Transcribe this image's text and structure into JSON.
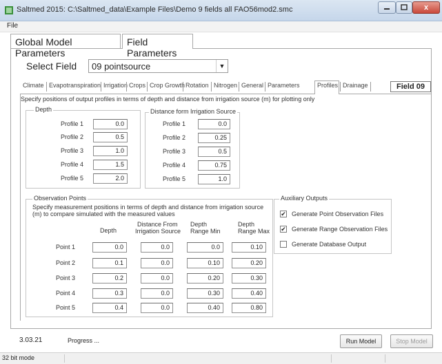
{
  "window": {
    "title": "Saltmed 2015: C:\\Saltmed_data\\Example Files\\Demo 9 fields all FAO56mod2.smc",
    "close_label": "x"
  },
  "menu": {
    "file": "File"
  },
  "main_tabs": [
    {
      "label": "Global Model Parameters"
    },
    {
      "label": "Field Parameters"
    }
  ],
  "select_field": {
    "label": "Select Field",
    "value": "09 pointsource"
  },
  "sub_tabs": [
    "Climate",
    "Evapotranspiration",
    "Irrigation",
    "Crops",
    "Crop Growth",
    "Rotation",
    "Nitrogen",
    "General",
    "Parameters",
    "Profiles",
    "Drainage"
  ],
  "active_sub_tab": "Profiles",
  "field_label": "Field 09",
  "instruction": "Specify positions of output profiles in terms of depth and distance from irrigation source  (m) for plotting only",
  "depth_group": {
    "title": "Depth",
    "rows": [
      {
        "label": "Profile 1",
        "value": "0.0"
      },
      {
        "label": "Profile 2",
        "value": "0.5"
      },
      {
        "label": "Profile 3",
        "value": "1.0"
      },
      {
        "label": "Profile 4",
        "value": "1.5"
      },
      {
        "label": "Profile 5",
        "value": "2.0"
      }
    ]
  },
  "distance_group": {
    "title": "Distance form Irrigation Source",
    "rows": [
      {
        "label": "Profile 1",
        "value": "0.0"
      },
      {
        "label": "Profile 2",
        "value": "0.25"
      },
      {
        "label": "Profile 3",
        "value": "0.5"
      },
      {
        "label": "Profile 4",
        "value": "0.75"
      },
      {
        "label": "Profile 5",
        "value": "1.0"
      }
    ]
  },
  "observation": {
    "title": "Observation Points",
    "desc1": "Specify measurement positions in terms of depth and distance from irrigation source",
    "desc2": "(m) to compare simulated with the measured values",
    "headers": {
      "depth": "Depth",
      "dist1": "Distance From",
      "dist2": "Irrigation Source",
      "rmin1": "Depth",
      "rmin2": "Range Min",
      "rmax1": "Depth",
      "rmax2": "Range Max"
    },
    "points": [
      {
        "label": "Point 1",
        "depth": "0.0",
        "distance": "0.0",
        "min": "0.0",
        "max": "0.10"
      },
      {
        "label": "Point 2",
        "depth": "0.1",
        "distance": "0.0",
        "min": "0.10",
        "max": "0.20"
      },
      {
        "label": "Point 3",
        "depth": "0.2",
        "distance": "0.0",
        "min": "0.20",
        "max": "0.30"
      },
      {
        "label": "Point 4",
        "depth": "0.3",
        "distance": "0.0",
        "min": "0.30",
        "max": "0.40"
      },
      {
        "label": "Point 5",
        "depth": "0.4",
        "distance": "0.0",
        "min": "0.40",
        "max": "0.80"
      }
    ]
  },
  "auxiliary": {
    "title": "Auxiliary Outputs",
    "options": [
      {
        "label": "Generate Point Observation Files",
        "checked": true
      },
      {
        "label": "Generate Range Observation Files",
        "checked": true
      },
      {
        "label": "Generate Database Output",
        "checked": false
      }
    ]
  },
  "bottom": {
    "version": "3.03.21",
    "progress_label": "Progress ...",
    "run_button": "Run Model",
    "stop_button": "Stop Model"
  },
  "status_bar": {
    "text": "32 bit mode"
  }
}
